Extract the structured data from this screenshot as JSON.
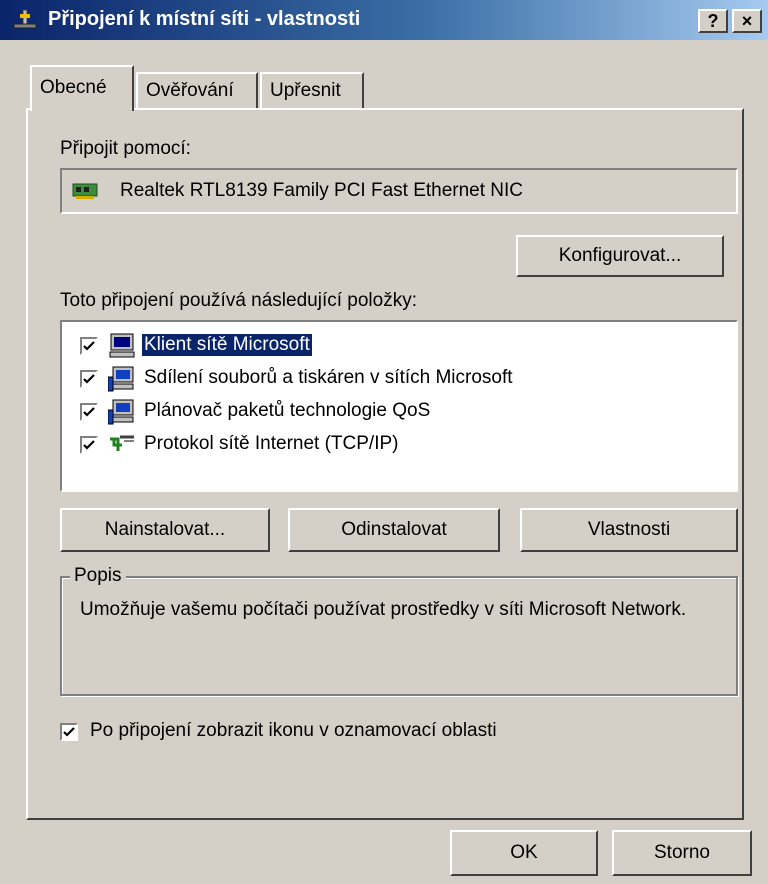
{
  "window": {
    "title": "Připojení k místní síti - vlastnosti",
    "help_label": "?",
    "close_label": "×"
  },
  "tabs": [
    {
      "label": "Obecné",
      "active": true
    },
    {
      "label": "Ověřování",
      "active": false
    },
    {
      "label": "Upřesnit",
      "active": false
    }
  ],
  "connect_using": {
    "label": "Připojit pomocí:",
    "adapter": "Realtek RTL8139 Family PCI Fast Ethernet NIC",
    "configure_button": "Konfigurovat..."
  },
  "items": {
    "label": "Toto připojení používá následující položky:",
    "list": [
      {
        "label": "Klient sítě Microsoft",
        "checked": true,
        "selected": true,
        "icon": "network-client-icon"
      },
      {
        "label": "Sdílení souborů a tiskáren v sítích Microsoft",
        "checked": true,
        "selected": false,
        "icon": "network-service-icon"
      },
      {
        "label": "Plánovač paketů technologie QoS",
        "checked": true,
        "selected": false,
        "icon": "network-service-icon"
      },
      {
        "label": "Protokol sítě Internet (TCP/IP)",
        "checked": true,
        "selected": false,
        "icon": "protocol-icon"
      }
    ],
    "install_button": "Nainstalovat...",
    "uninstall_button": "Odinstalovat",
    "properties_button": "Vlastnosti"
  },
  "description": {
    "legend": "Popis",
    "text": "Umožňuje vašemu počítači používat prostředky v síti Microsoft Network."
  },
  "notify_checkbox": {
    "label": "Po připojení zobrazit ikonu v oznamovací oblasti",
    "checked": true
  },
  "footer": {
    "ok_button": "OK",
    "cancel_button": "Storno"
  }
}
